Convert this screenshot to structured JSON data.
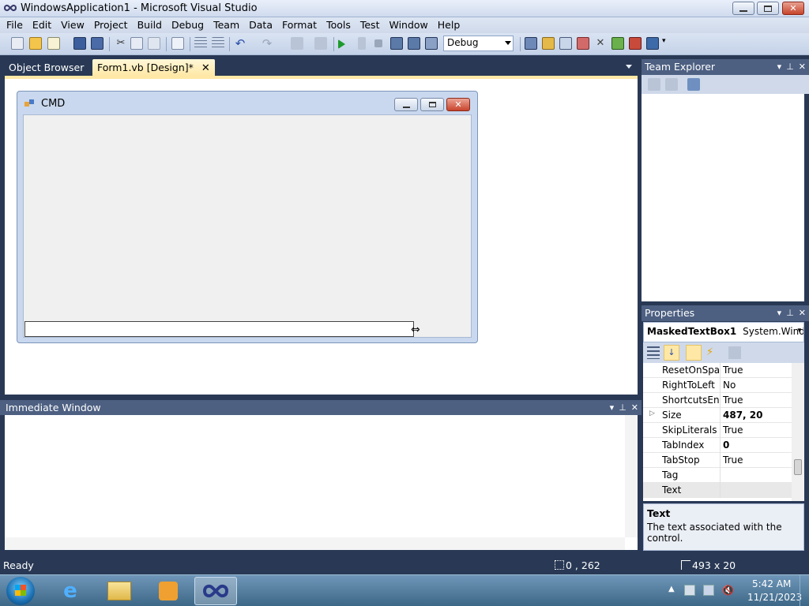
{
  "window": {
    "title": "WindowsApplication1 - Microsoft Visual Studio"
  },
  "menu": [
    "File",
    "Edit",
    "View",
    "Project",
    "Build",
    "Debug",
    "Team",
    "Data",
    "Format",
    "Tools",
    "Test",
    "Window",
    "Help"
  ],
  "toolbar": {
    "configuration": "Debug"
  },
  "doc_tabs": {
    "object_browser": "Object Browser",
    "design": "Form1.vb [Design]*",
    "close": "✕"
  },
  "form": {
    "title": "CMD"
  },
  "immediate": {
    "title": "Immediate Window"
  },
  "team_explorer": {
    "title": "Team Explorer"
  },
  "properties": {
    "title": "Properties",
    "object_name": "MaskedTextBox1",
    "object_type": "System.Windov",
    "rows": [
      {
        "name": "ResetOnSpac",
        "value": "True"
      },
      {
        "name": "RightToLeft",
        "value": "No"
      },
      {
        "name": "ShortcutsEnal",
        "value": "True"
      },
      {
        "name": "Size",
        "value": "487, 20"
      },
      {
        "name": "SkipLiterals",
        "value": "True"
      },
      {
        "name": "TabIndex",
        "value": "0"
      },
      {
        "name": "TabStop",
        "value": "True"
      },
      {
        "name": "Tag",
        "value": ""
      },
      {
        "name": "Text",
        "value": ""
      }
    ],
    "desc_title": "Text",
    "desc_text": "The text associated with the control."
  },
  "status": {
    "ready": "Ready",
    "position": "0 , 262",
    "size": "493 x 20"
  },
  "taskbar": {
    "time": "5:42 AM",
    "date": "11/21/2023"
  },
  "colors": {
    "chrome": "#293955",
    "panel_header": "#4d6082",
    "active_tab": "#ffe8a6"
  }
}
